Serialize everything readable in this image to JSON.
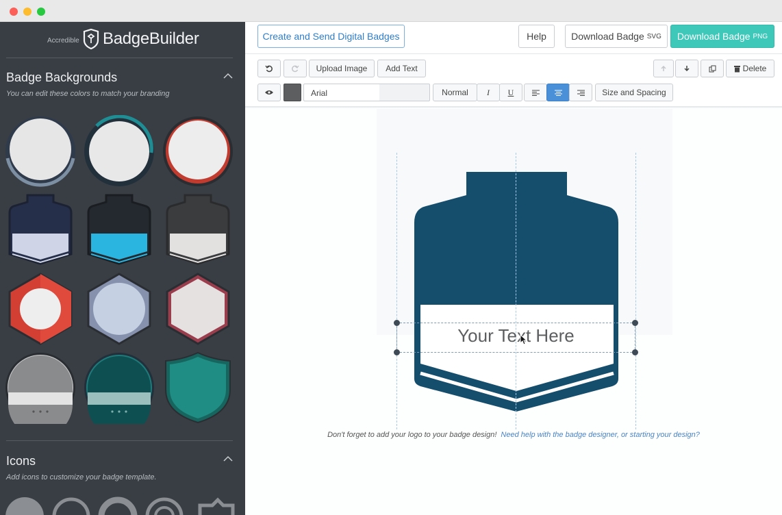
{
  "window": {
    "controls": [
      "close",
      "minimize",
      "zoom"
    ]
  },
  "brand": {
    "prefix": "Accredible",
    "name": "BadgeBuilder"
  },
  "sidebar": {
    "backgrounds": {
      "title": "Badge Backgrounds",
      "subtitle": "You can edit these colors to match your branding",
      "items": [
        {
          "shape": "circle",
          "ring": "#2f3a4a",
          "accent": "#7d8fa3"
        },
        {
          "shape": "circle",
          "ring": "#22303b",
          "accent": "#1f8d94"
        },
        {
          "shape": "circle",
          "ring": "#2a2e33",
          "accent": "#c23b2f"
        },
        {
          "shape": "jar",
          "top": "#252f4a",
          "band": "#cfd5e6"
        },
        {
          "shape": "jar",
          "top": "#24292f",
          "band": "#2ab4e0"
        },
        {
          "shape": "jar",
          "top": "#3b3c3e",
          "band": "#e3e0e0"
        },
        {
          "shape": "hexagon",
          "outer": "#d34033",
          "inner": "#eeeeee"
        },
        {
          "shape": "hexagon",
          "outer": "#8692ad",
          "inner": "#c5d0e2"
        },
        {
          "shape": "hexagon",
          "outer": "#9a3e4d",
          "inner": "#e6e1e1"
        },
        {
          "shape": "seal",
          "top": "#8a8b8d",
          "band": "#e3e3e3"
        },
        {
          "shape": "seal",
          "top": "#0e4f52",
          "band": "#9bbfbd"
        },
        {
          "shape": "shield",
          "fill": "#1f8d83",
          "ring": "#16655e"
        }
      ]
    },
    "icons": {
      "title": "Icons",
      "subtitle": "Add icons to customize your badge template."
    }
  },
  "header": {
    "create_label": "Create and Send Digital Badges",
    "help_label": "Help",
    "download_svg": {
      "label": "Download Badge",
      "suffix": "SVG"
    },
    "download_png": {
      "label": "Download Badge",
      "suffix": "PNG"
    }
  },
  "toolbar": {
    "upload_label": "Upload Image",
    "add_text_label": "Add Text",
    "delete_label": "Delete",
    "font_value": "Arial",
    "weight_label": "Normal",
    "italic_label": "I",
    "underline_label": "U",
    "size_spacing_label": "Size and Spacing",
    "text_color": "#5d5e60",
    "active_alignment": "center"
  },
  "canvas": {
    "badge_text": "Your Text Here",
    "badge_color": "#154d6c",
    "note": "Don't forget to add your logo to your badge design!",
    "help_link": "Need help with the badge designer, or starting your design?"
  }
}
